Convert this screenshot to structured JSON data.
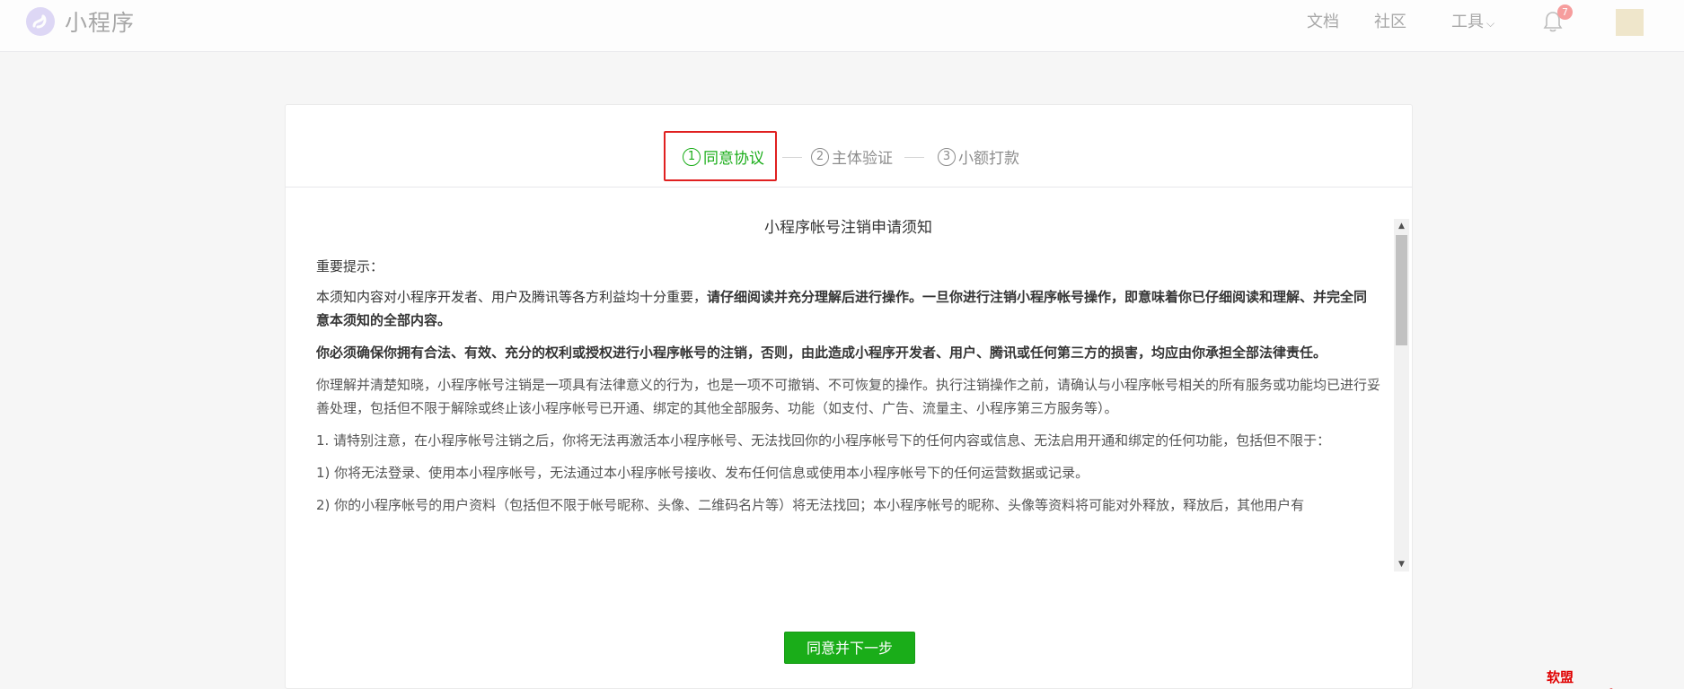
{
  "header": {
    "logo_text": "小程序",
    "nav": {
      "docs": "文档",
      "community": "社区",
      "tools": "工具"
    },
    "notification_count": "7",
    "icons": {
      "logo": "miniprogram-logo-icon",
      "tools_dropdown": "chevron-down-icon",
      "bell": "bell-icon"
    }
  },
  "steps": [
    {
      "num": "1",
      "label": "同意协议",
      "active": true
    },
    {
      "num": "2",
      "label": "主体验证",
      "active": false
    },
    {
      "num": "3",
      "label": "小额打款",
      "active": false
    }
  ],
  "notice": {
    "title": "小程序帐号注销申请须知",
    "important_heading": "重要提示：",
    "p1_normal": "本须知内容对小程序开发者、用户及腾讯等各方利益均十分重要，",
    "p1_bold": "请仔细阅读并充分理解后进行操作。一旦你进行注销小程序帐号操作，即意味着你已仔细阅读和理解、并完全同意本须知的全部内容。",
    "p2_bold": "你必须确保你拥有合法、有效、充分的权利或授权进行小程序帐号的注销，否则，由此造成小程序开发者、用户、腾讯或任何第三方的损害，均应由你承担全部法律责任。",
    "p3": "你理解并清楚知晓，小程序帐号注销是一项具有法律意义的行为，也是一项不可撤销、不可恢复的操作。执行注销操作之前，请确认与小程序帐号相关的所有服务或功能均已进行妥善处理，包括但不限于解除或终止该小程序帐号已开通、绑定的其他全部服务、功能（如支付、广告、流量主、小程序第三方服务等）。",
    "p4": "1. 请特别注意，在小程序帐号注销之后，你将无法再激活本小程序帐号、无法找回你的小程序帐号下的任何内容或信息、无法启用开通和绑定的任何功能，包括但不限于：",
    "p5": "1) 你将无法登录、使用本小程序帐号，无法通过本小程序帐号接收、发布任何信息或使用本小程序帐号下的任何运营数据或记录。",
    "p6": "2) 你的小程序帐号的用户资料（包括但不限于帐号昵称、头像、二维码名片等）将无法找回；本小程序帐号的昵称、头像等资料将可能对外释放，释放后，其他用户有"
  },
  "primary_button": "同意并下一步",
  "watermark": "软盟www.rmbox.cn",
  "colors": {
    "accent_green": "#1aad19",
    "highlight_red": "#e02020",
    "badge": "#f68e8e"
  }
}
